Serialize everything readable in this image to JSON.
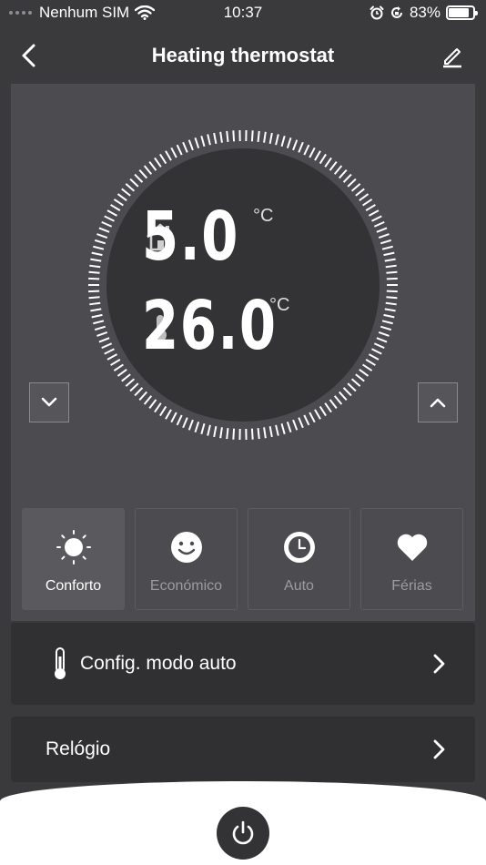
{
  "status_bar": {
    "carrier": "Nenhum SIM",
    "time": "10:37",
    "battery": "83%",
    "battery_level": 0.83,
    "icons": [
      "signal-dots-icon",
      "wifi-icon",
      "alarm-icon",
      "orientation-lock-icon",
      "battery-icon"
    ]
  },
  "nav": {
    "title": "Heating thermostat",
    "back_icon": "chevron-left-icon",
    "edit_icon": "pencil-icon"
  },
  "thermostat": {
    "set_temperature": "5.0",
    "set_unit": "°C",
    "set_icon": "house-icon",
    "current_temperature": "26.0",
    "current_unit": "°C",
    "current_icon": "thermometer-icon",
    "decrease_icon": "chevron-down-icon",
    "increase_icon": "chevron-up-icon"
  },
  "modes": [
    {
      "label": "Conforto",
      "icon": "sun-icon",
      "active": true
    },
    {
      "label": "Económico",
      "icon": "smiley-icon",
      "active": false
    },
    {
      "label": "Auto",
      "icon": "clock-icon",
      "active": false
    },
    {
      "label": "Férias",
      "icon": "heart-icon",
      "active": false
    }
  ],
  "settings": {
    "auto_config_label": "Config. modo auto",
    "clock_label": "Relógio"
  },
  "colors": {
    "background": "#3a3a3d",
    "panel": "#4c4c50",
    "dial": "#333336",
    "row": "#303033",
    "accent_text": "#ffffff",
    "inactive_text": "#9c9ca0"
  }
}
